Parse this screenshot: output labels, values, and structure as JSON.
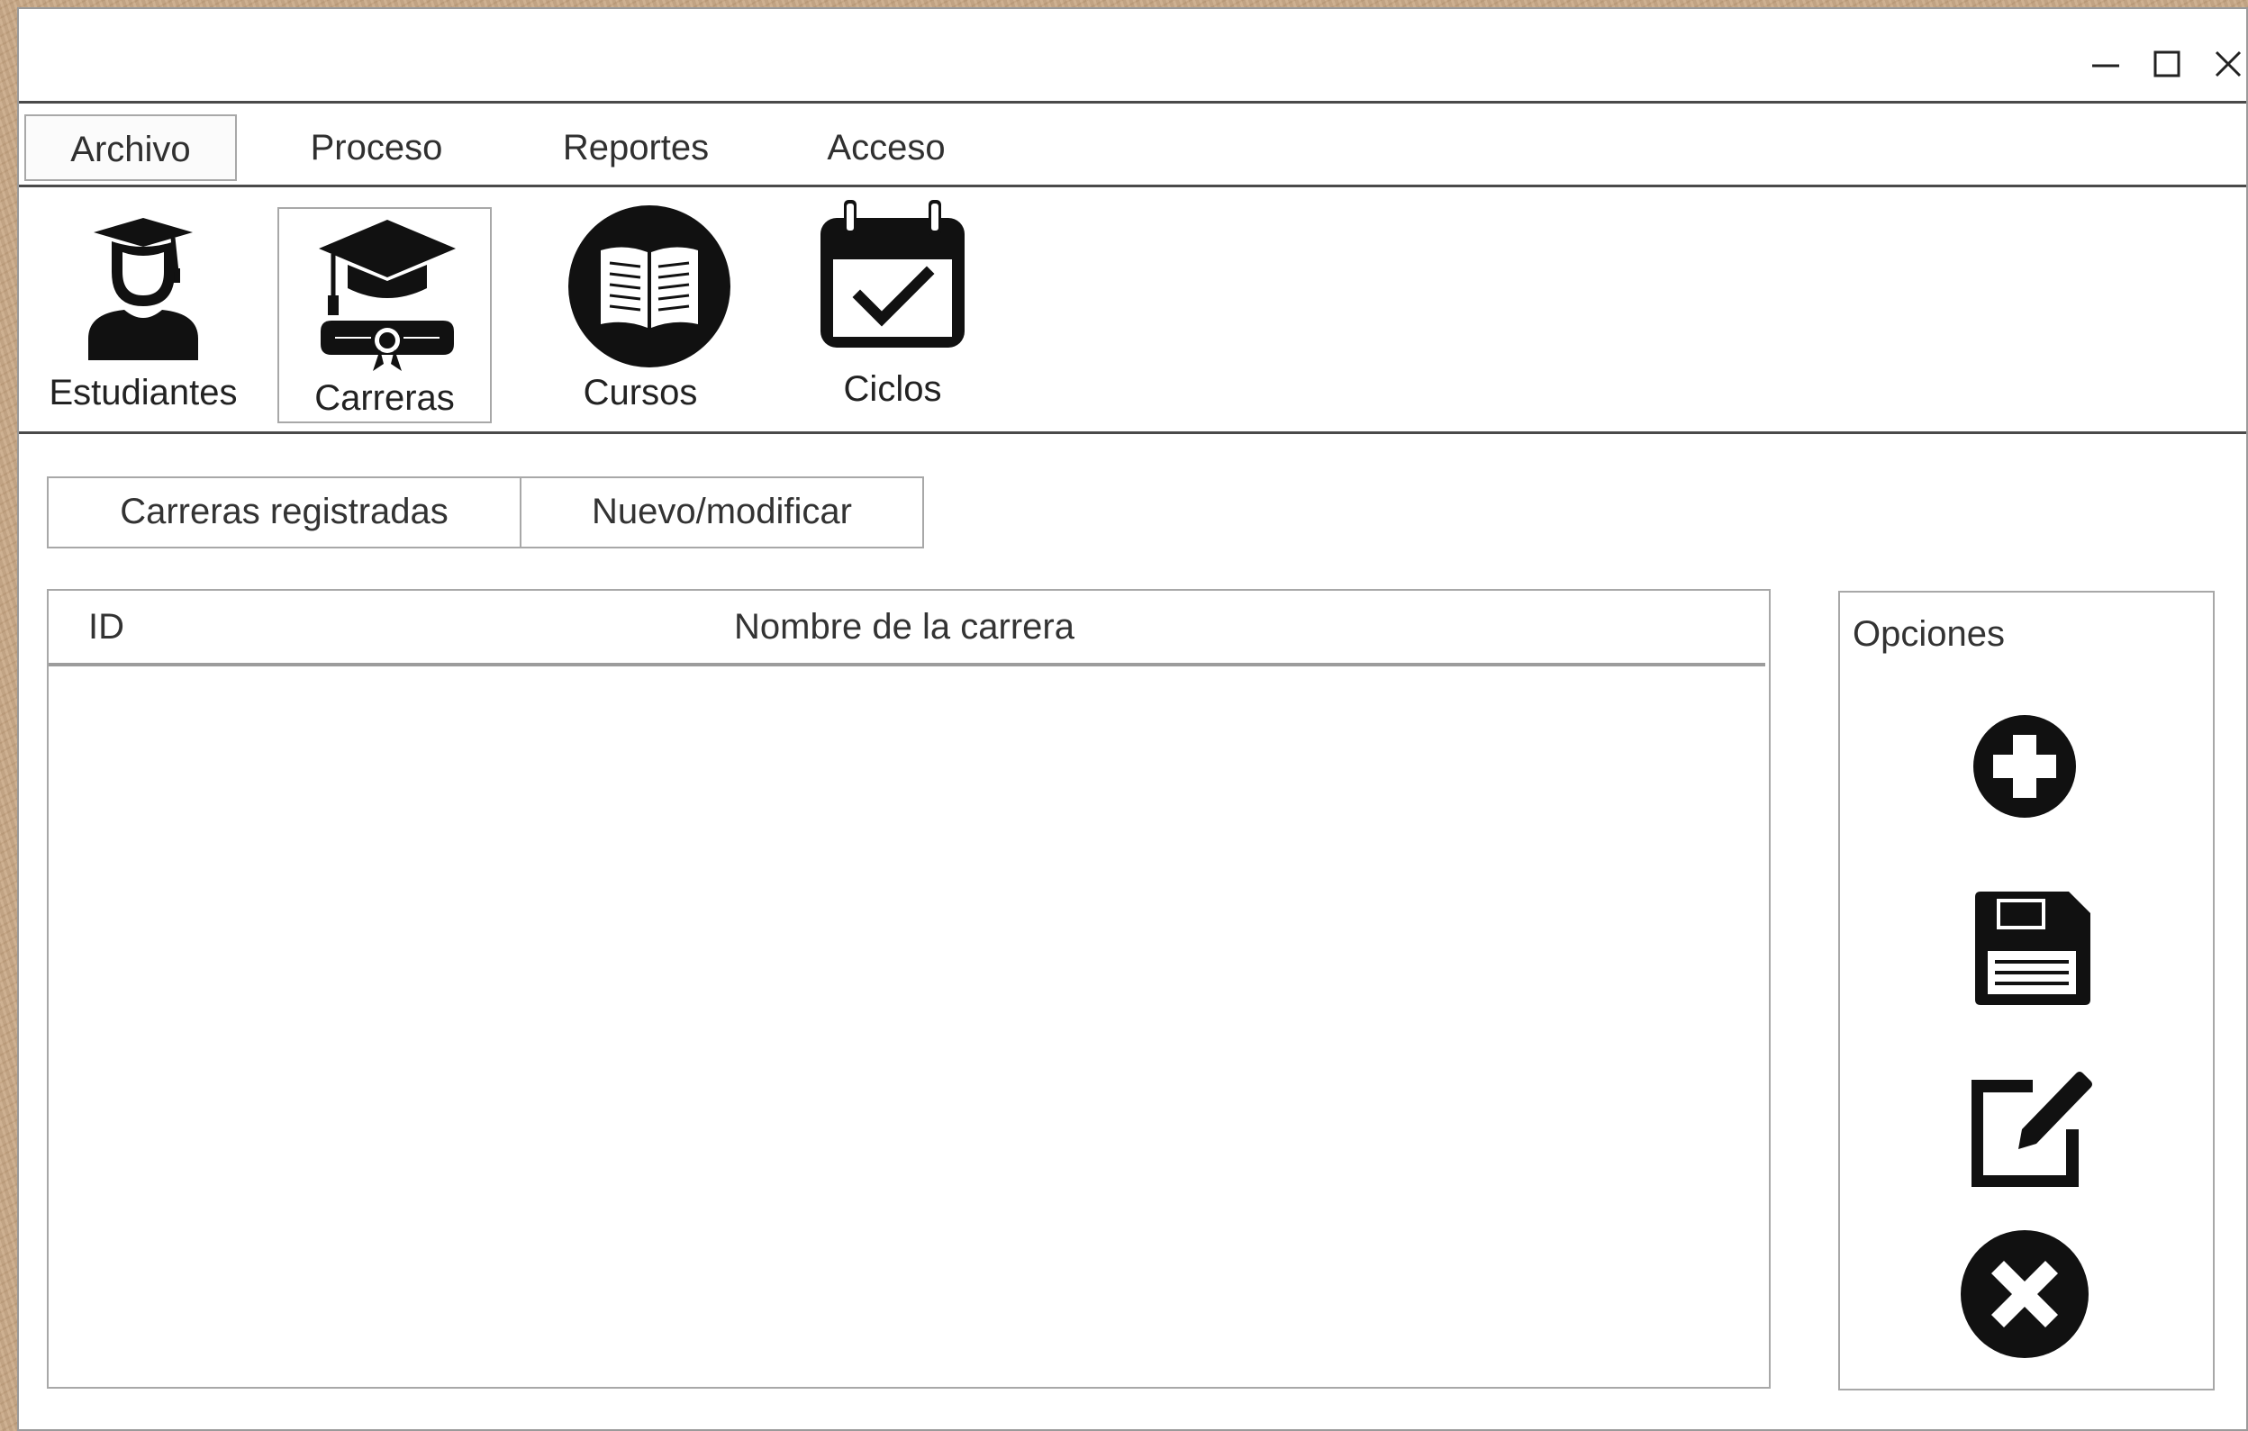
{
  "window": {
    "controls": [
      {
        "name": "minimize",
        "icon": "minimize-icon"
      },
      {
        "name": "maximize",
        "icon": "maximize-icon"
      },
      {
        "name": "close",
        "icon": "close-icon"
      }
    ]
  },
  "menu": {
    "items": [
      {
        "label": "Archivo",
        "active": true
      },
      {
        "label": "Proceso",
        "active": false
      },
      {
        "label": "Reportes",
        "active": false
      },
      {
        "label": "Acceso",
        "active": false
      }
    ]
  },
  "ribbon": {
    "buttons": [
      {
        "label": "Estudiantes",
        "icon": "student-icon",
        "selected": false
      },
      {
        "label": "Carreras",
        "icon": "graduation-diploma-icon",
        "selected": true
      },
      {
        "label": "Cursos",
        "icon": "book-icon",
        "selected": false
      },
      {
        "label": "Ciclos",
        "icon": "calendar-check-icon",
        "selected": false
      }
    ]
  },
  "tabs": [
    {
      "label": "Carreras registradas"
    },
    {
      "label": "Nuevo/modificar"
    }
  ],
  "grid": {
    "columns": [
      "ID",
      "Nombre de la carrera"
    ],
    "rows": []
  },
  "options": {
    "title": "Opciones",
    "buttons": [
      {
        "name": "add",
        "icon": "add-circle-icon"
      },
      {
        "name": "save",
        "icon": "save-icon"
      },
      {
        "name": "edit",
        "icon": "edit-icon"
      },
      {
        "name": "delete",
        "icon": "delete-circle-icon"
      }
    ]
  },
  "colors": {
    "icon": "#111111",
    "border": "#a8a8a8",
    "divider": "#4a4a4a",
    "window_bg": "#ffffff"
  }
}
